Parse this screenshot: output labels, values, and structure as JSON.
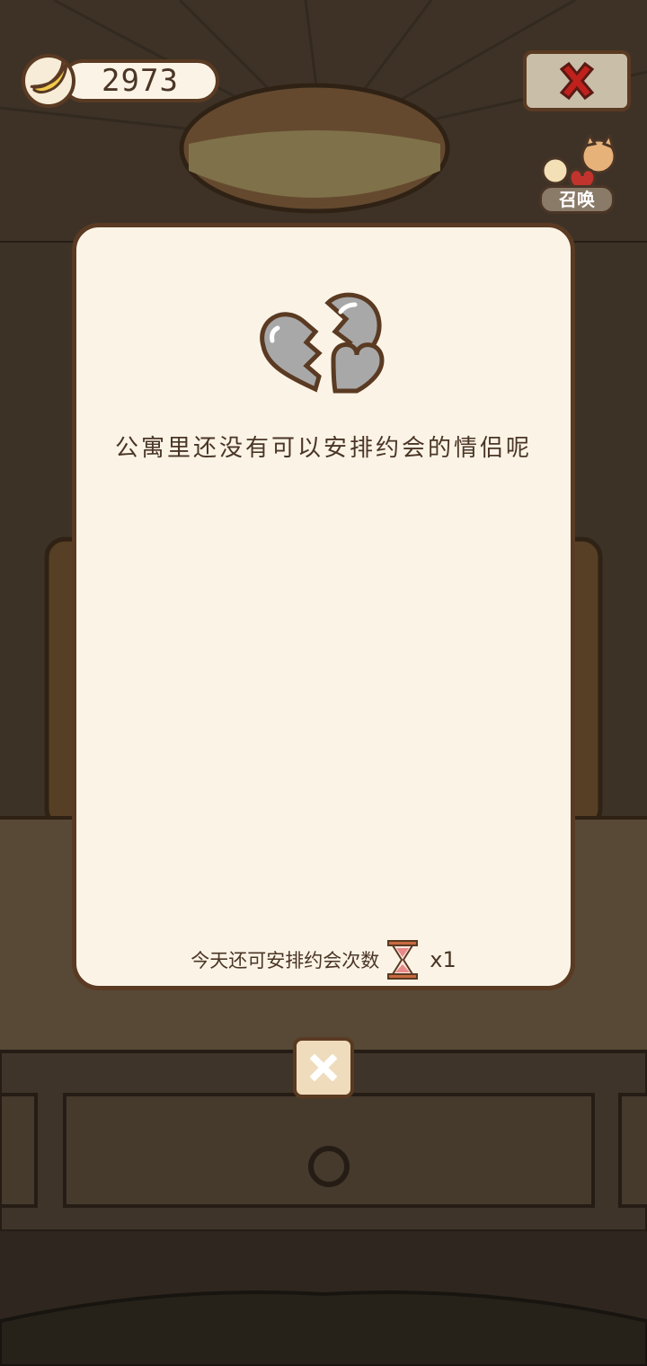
{
  "currency": {
    "icon": "banana-icon",
    "value": "2973"
  },
  "top_close": {
    "icon": "close-icon",
    "color": "#c0211c"
  },
  "summon": {
    "label": "召唤",
    "icon": "cat-couple-icon"
  },
  "dialog": {
    "icon": "broken-heart-icon",
    "message": "公寓里还没有可以安排约会的情侣呢",
    "footer_label": "今天还可安排约会次数",
    "footer_icon": "hourglass-icon",
    "footer_count": "x1"
  },
  "bottom_close": {
    "icon": "close-icon"
  },
  "colors": {
    "panel": "#fbf4e6",
    "outline": "#5a3a22",
    "text": "#4a3526"
  }
}
